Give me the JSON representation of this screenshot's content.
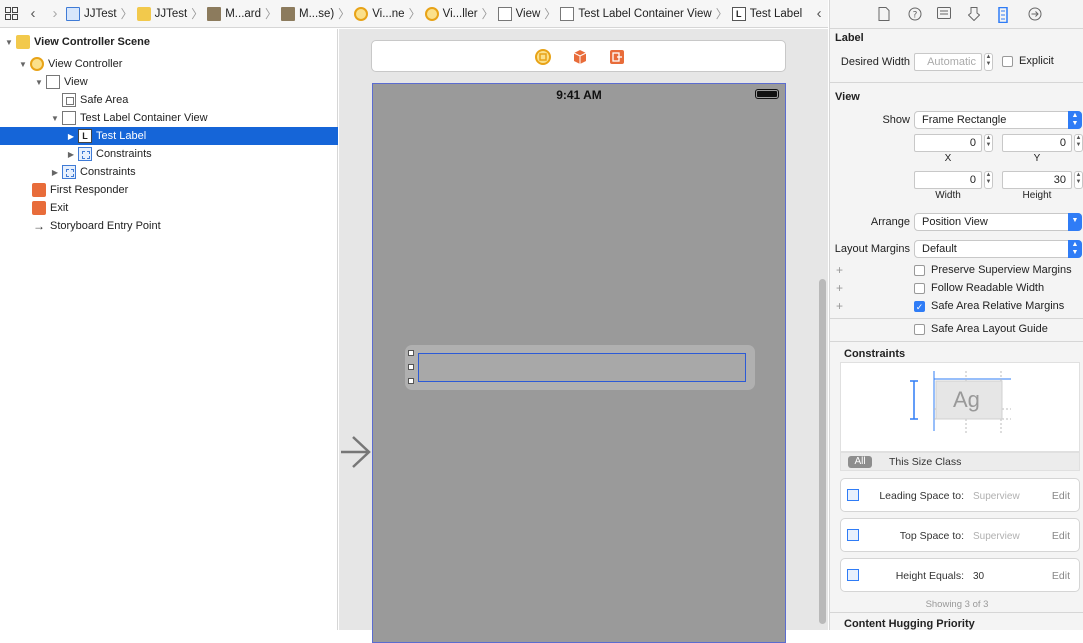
{
  "jumpbar": {
    "crumbs": [
      {
        "label": "JJTest",
        "icon": "project-file-icon"
      },
      {
        "label": "JJTest",
        "icon": "folder-icon"
      },
      {
        "label": "M...ard",
        "icon": "storyboard-icon"
      },
      {
        "label": "M...se)",
        "icon": "storyboard-icon"
      },
      {
        "label": "Vi...ne",
        "icon": "scene-icon"
      },
      {
        "label": "Vi...ller",
        "icon": "view-controller-icon"
      },
      {
        "label": "View",
        "icon": "view-icon"
      },
      {
        "label": "Test Label Container View",
        "icon": "view-icon"
      },
      {
        "label": "Test Label",
        "icon": "label-icon"
      }
    ]
  },
  "outline": {
    "items": [
      {
        "label": "View Controller Scene"
      },
      {
        "label": "View Controller"
      },
      {
        "label": "View"
      },
      {
        "label": "Safe Area"
      },
      {
        "label": "Test Label Container View"
      },
      {
        "label": "Test Label"
      },
      {
        "label": "Constraints"
      },
      {
        "label": "Constraints"
      },
      {
        "label": "First Responder"
      },
      {
        "label": "Exit"
      },
      {
        "label": "Storyboard Entry Point"
      }
    ]
  },
  "canvas": {
    "status_time": "9:41 AM"
  },
  "inspector": {
    "label_section": {
      "title": "Label",
      "desired_width_label": "Desired Width",
      "desired_width_placeholder": "Automatic",
      "explicit_label": "Explicit"
    },
    "view_section": {
      "title": "View",
      "show_label": "Show",
      "show_value": "Frame Rectangle",
      "x_value": "0",
      "x_label": "X",
      "y_value": "0",
      "y_label": "Y",
      "width_value": "0",
      "width_label": "Width",
      "height_value": "30",
      "height_label": "Height",
      "arrange_label": "Arrange",
      "arrange_value": "Position View",
      "layout_margins_label": "Layout Margins",
      "layout_margins_value": "Default",
      "preserve_superview_margins": "Preserve Superview Margins",
      "follow_readable_width": "Follow Readable Width",
      "safe_area_relative_margins": "Safe Area Relative Margins",
      "safe_area_layout_guide": "Safe Area Layout Guide"
    },
    "constraints_section": {
      "title": "Constraints",
      "preview_text": "Ag",
      "size_class_all": "All",
      "size_class_this": "This Size Class",
      "items": [
        {
          "kind": "Leading Space to:",
          "value": "Superview",
          "edit": "Edit"
        },
        {
          "kind": "Top Space to:",
          "value": "Superview",
          "edit": "Edit"
        },
        {
          "kind": "Height Equals:",
          "value": "30",
          "edit": "Edit"
        }
      ],
      "showing": "Showing 3 of 3"
    },
    "content_hugging_title": "Content Hugging Priority"
  }
}
